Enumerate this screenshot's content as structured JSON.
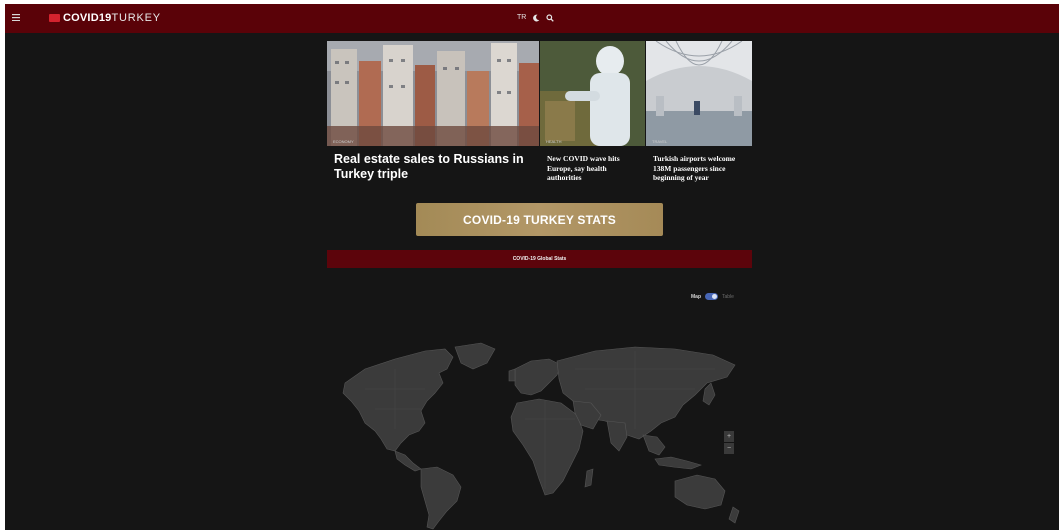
{
  "header": {
    "menu_icon": "menu-icon",
    "logo_bold": "COVID19",
    "logo_light": "TURKEY",
    "tools": {
      "language": "TR",
      "dark_mode_icon": "moon-icon",
      "search_icon": "search-icon"
    }
  },
  "news": [
    {
      "tag": "ECONOMY",
      "title": "Real estate sales to Russians in Turkey triple"
    },
    {
      "tag": "HEALTH",
      "title": "New COVID wave hits Europe, say health authorities"
    },
    {
      "tag": "TRAVEL",
      "title": "Turkish airports welcome 138M passengers since beginning of year"
    }
  ],
  "stats_button": "COVID-19 TURKEY STATS",
  "global_bar": "COVID-19 Global Stats",
  "toggle": {
    "on_label": "Map",
    "off_label": "Table",
    "state": "map"
  },
  "map": {
    "land_color": "#3b3b3b",
    "border_color": "#555555"
  },
  "zoom": {
    "in": "+",
    "out": "−"
  }
}
